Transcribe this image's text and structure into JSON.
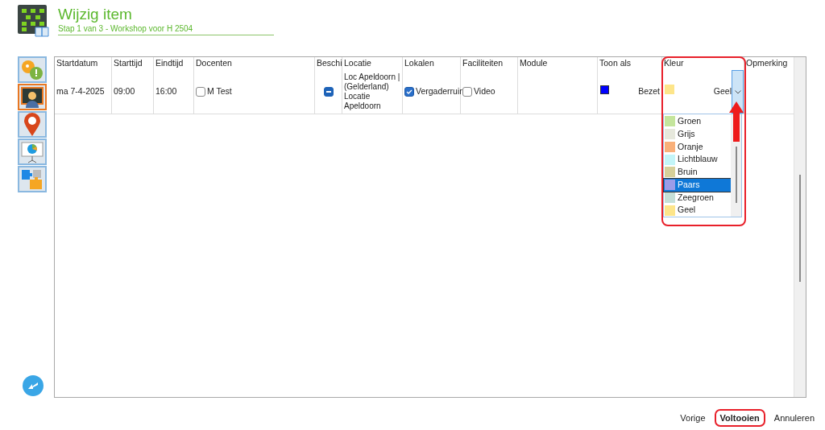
{
  "header": {
    "title": "Wijzig item",
    "subtitle": "Stap 1 van 3 - Workshop voor H 2504"
  },
  "side_nav": [
    {
      "kind": "help",
      "selected": false
    },
    {
      "kind": "teacher",
      "selected": true
    },
    {
      "kind": "location",
      "selected": false
    },
    {
      "kind": "presentation",
      "selected": false
    },
    {
      "kind": "puzzle",
      "selected": false
    }
  ],
  "table": {
    "columns": [
      "Startdatum",
      "Starttijd",
      "Eindtijd",
      "Docenten",
      "Beschi",
      "Locatie",
      "Lokalen",
      "Faciliteiten",
      "Module",
      "Toon als",
      "Kleur",
      "Opmerking"
    ],
    "rows": [
      {
        "startdatum": "ma 7-4-2025",
        "starttijd": "09:00",
        "eindtijd": "16:00",
        "docent": {
          "label": "M Test",
          "checked": false
        },
        "beschikbaar": {
          "indeterminate": true
        },
        "locatie": "Loc Apeldoorn | (Gelderland) Locatie Apeldoorn",
        "lokaal": {
          "label": "Vergaderruir",
          "checked": true
        },
        "faciliteit": {
          "label": "Video",
          "checked": false
        },
        "toon_als": {
          "label": "Bezet",
          "color": "#0000ff"
        },
        "kleur": {
          "value": "Geel",
          "color": "#fde58a"
        }
      }
    ]
  },
  "color_dropdown": {
    "options": [
      {
        "label": "Groen",
        "color": "#c4e59c",
        "selected": false
      },
      {
        "label": "Grijs",
        "color": "#e6e8dc",
        "selected": false
      },
      {
        "label": "Oranje",
        "color": "#f9b07a",
        "selected": false
      },
      {
        "label": "Lichtblauw",
        "color": "#c3f5f8",
        "selected": false
      },
      {
        "label": "Bruin",
        "color": "#d7d09a",
        "selected": false
      },
      {
        "label": "Paars",
        "color": "#9c9ce8",
        "selected": true
      },
      {
        "label": "Zeegroen",
        "color": "#c5e0d8",
        "selected": false
      },
      {
        "label": "Geel",
        "color": "#fde58a",
        "selected": false
      }
    ]
  },
  "buttons": [
    {
      "label": "Vorige",
      "kind": "default"
    },
    {
      "label": "Voltooien",
      "kind": "primary"
    },
    {
      "label": "Annuleren",
      "kind": "default"
    }
  ]
}
